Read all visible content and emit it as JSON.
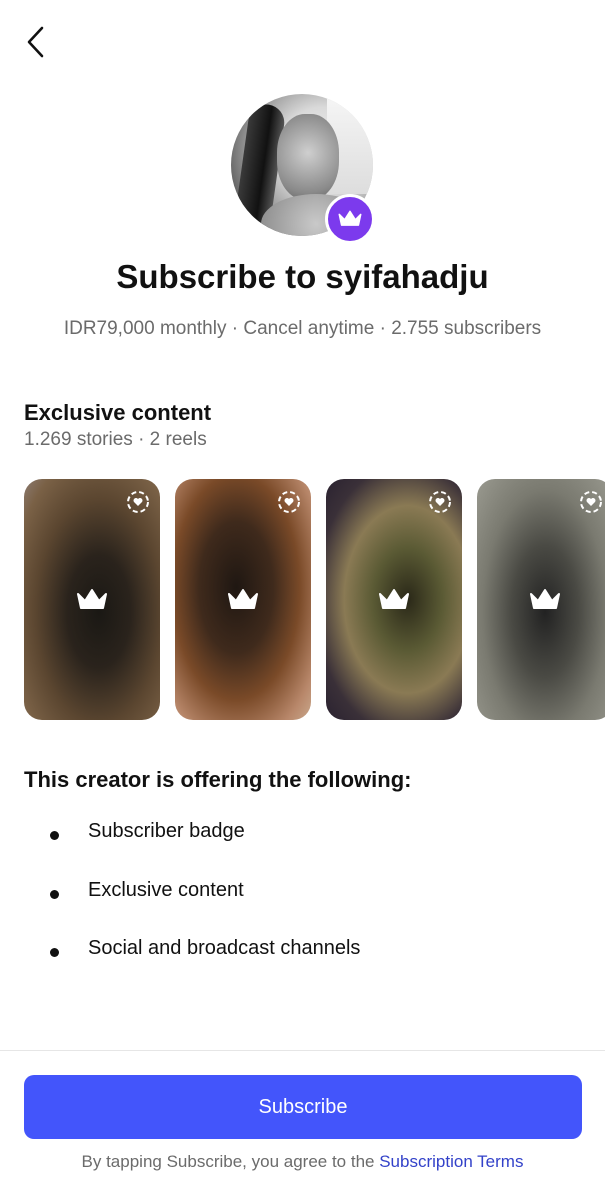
{
  "header": {
    "back_icon": "chevron-left-icon"
  },
  "profile": {
    "avatar_icon": "profile-avatar",
    "badge_icon": "crown-icon",
    "badge_color": "#7c3aed"
  },
  "title": "Subscribe to syifahadju",
  "subtitle": "IDR79,000 monthly · Cancel anytime · 2.755 subscribers",
  "exclusive": {
    "heading": "Exclusive content",
    "summary": "1.269 stories · 2 reels",
    "tiles": [
      {
        "locked_icon": "crown-icon",
        "indicator_icon": "close-friends-story-icon"
      },
      {
        "locked_icon": "crown-icon",
        "indicator_icon": "close-friends-story-icon"
      },
      {
        "locked_icon": "crown-icon",
        "indicator_icon": "close-friends-story-icon"
      },
      {
        "locked_icon": "crown-icon",
        "indicator_icon": "close-friends-story-icon"
      }
    ]
  },
  "offer": {
    "heading": "This creator is offering the following:",
    "items": [
      "Subscriber badge",
      "Exclusive content",
      "Social and broadcast channels"
    ]
  },
  "footer": {
    "subscribe_label": "Subscribe",
    "terms_prefix": "By tapping Subscribe, you agree to the ",
    "terms_link": "Subscription Terms",
    "button_color": "#4355fb",
    "link_color": "#3342c9"
  }
}
